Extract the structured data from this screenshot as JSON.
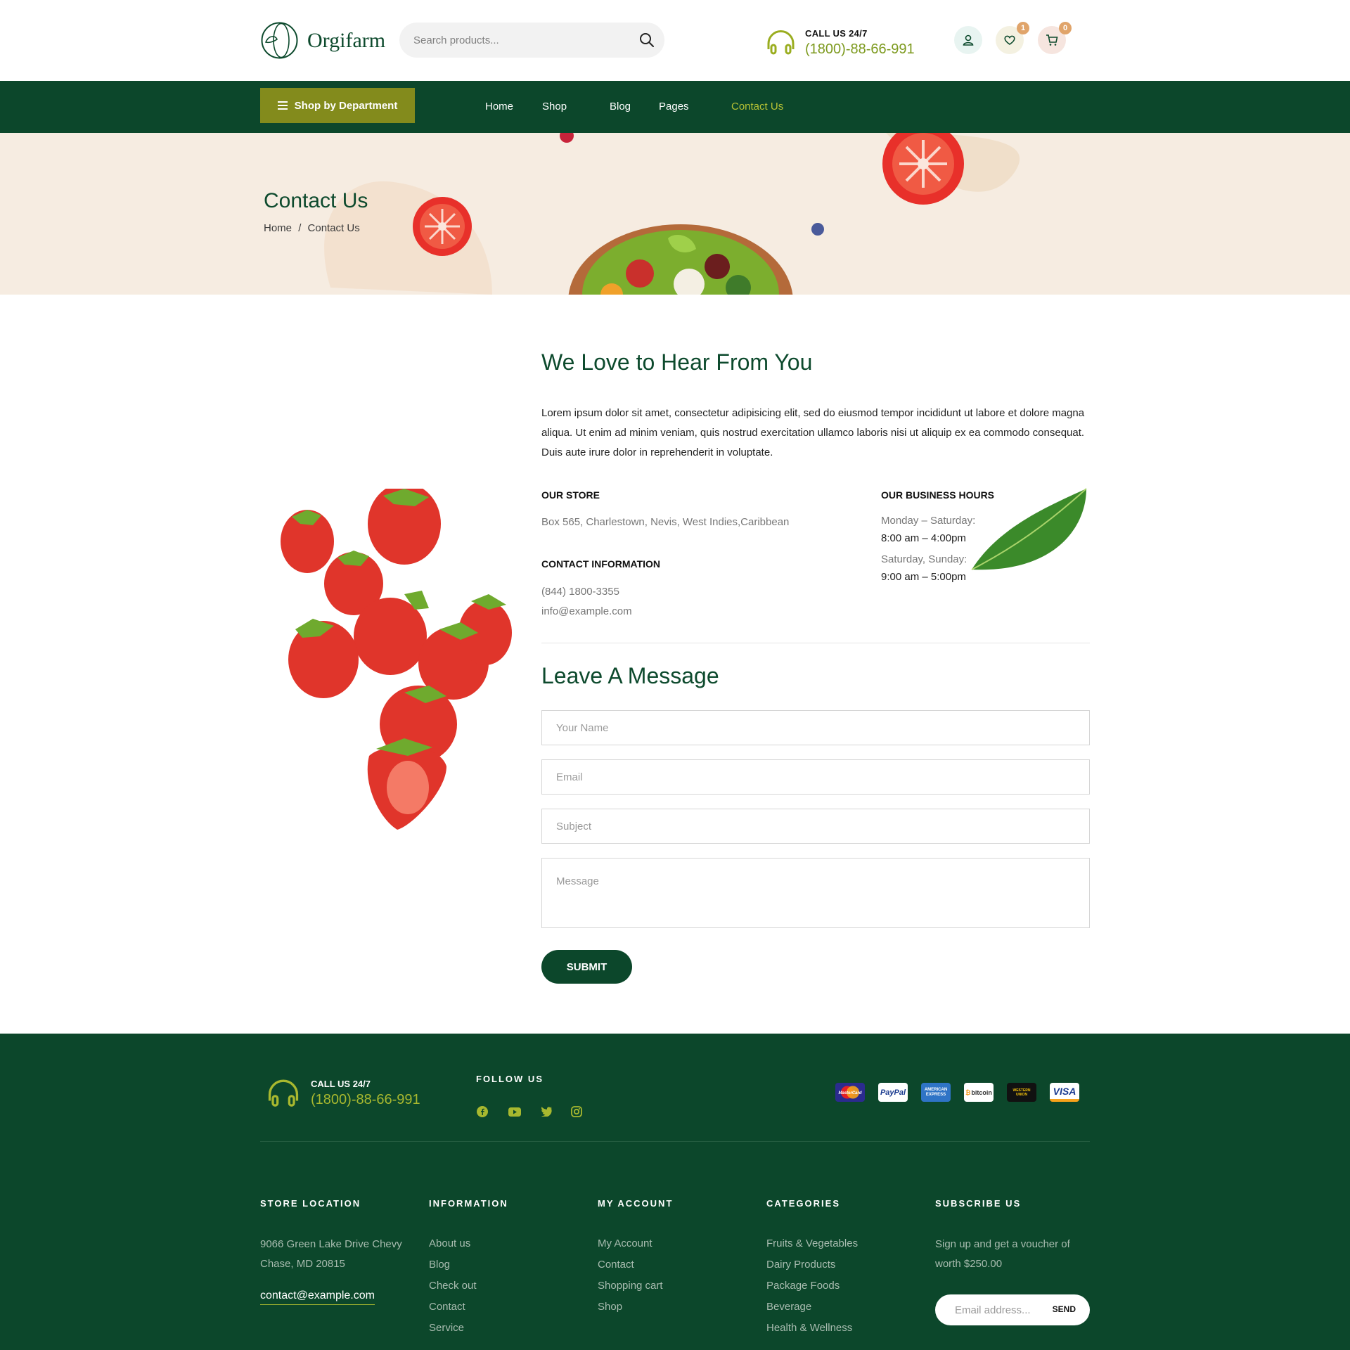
{
  "header": {
    "logo_text": "Orgifarm",
    "search_placeholder": "Search products...",
    "call_label": "CALL US 24/7",
    "call_number": "(1800)-88-66-991",
    "wishlist_count": "1",
    "cart_count": "0"
  },
  "nav": {
    "department_label": "Shop by Department",
    "links": [
      "Home",
      "Shop",
      "Blog",
      "Pages",
      "Contact Us"
    ],
    "active_color": "#b8c335"
  },
  "banner": {
    "title": "Contact Us",
    "breadcrumb": [
      "Home",
      "/",
      "Contact Us"
    ]
  },
  "main": {
    "heading": "We Love to Hear From You",
    "intro": "Lorem ipsum dolor sit amet, consectetur adipisicing elit, sed do eiusmod tempor incididunt ut labore et dolore magna aliqua. Ut enim ad minim veniam, quis nostrud exercitation ullamco laboris nisi ut aliquip ex ea commodo consequat. Duis aute irure dolor in reprehenderit in voluptate.",
    "store_heading": "OUR STORE",
    "store_address": "Box 565, Charlestown, Nevis, West Indies,Caribbean",
    "contact_heading": "CONTACT INFORMATION",
    "contact_phone": "(844) 1800-3355",
    "contact_email": "info@example.com",
    "hours_heading": "OUR BUSINESS HOURS",
    "hours": [
      {
        "days": "Monday – Saturday:",
        "time": "8:00 am – 4:00pm"
      },
      {
        "days": "Saturday, Sunday:",
        "time": "9:00 am – 5:00pm"
      }
    ],
    "form_heading": "Leave A Message",
    "name_placeholder": "Your Name",
    "email_placeholder": "Email",
    "subject_placeholder": "Subject",
    "message_placeholder": "Message",
    "submit_label": "SUBMIT"
  },
  "footer": {
    "call_label": "CALL US 24/7",
    "call_number": "(1800)-88-66-991",
    "follow_heading": "FOLLOW US",
    "social_icons": [
      "facebook-icon",
      "youtube-icon",
      "twitter-icon",
      "instagram-icon"
    ],
    "payments": [
      "MasterCard",
      "PayPal",
      "AMERICAN EXPRESS",
      "bitcoin",
      "WESTERN UNION",
      "VISA"
    ],
    "store_heading": "STORE LOCATION",
    "store_address": "9066 Green Lake Drive Chevy Chase, MD 20815",
    "store_email": "contact@example.com",
    "info_heading": "INFORMATION",
    "info_links": [
      "About us",
      "Blog",
      "Check out",
      "Contact",
      "Service"
    ],
    "account_heading": "MY ACCOUNT",
    "account_links": [
      "My Account",
      "Contact",
      "Shopping cart",
      "Shop"
    ],
    "categories_heading": "CATEGORIES",
    "category_links": [
      "Fruits & Vegetables",
      "Dairy Products",
      "Package Foods",
      "Beverage",
      "Health & Wellness"
    ],
    "subscribe_heading": "SUBSCRIBE US",
    "subscribe_text": "Sign up and get a voucher of worth $250.00",
    "subscribe_placeholder": "Email address...",
    "subscribe_button": "SEND"
  },
  "colors": {
    "brand_green": "#0c472b",
    "accent_olive": "#838b1c",
    "accent_lime": "#a8b82f",
    "banner_bg": "#f6ece1"
  }
}
